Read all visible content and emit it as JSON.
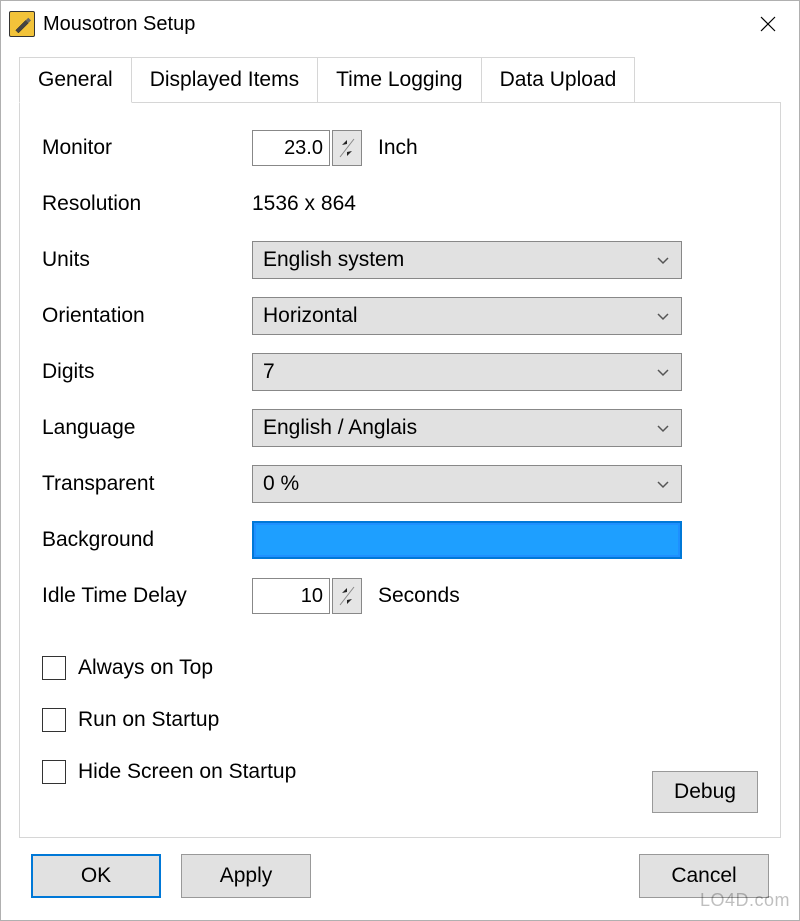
{
  "titlebar": {
    "title": "Mousotron Setup"
  },
  "tabs": {
    "general": "General",
    "displayed_items": "Displayed Items",
    "time_logging": "Time Logging",
    "data_upload": "Data Upload"
  },
  "form": {
    "monitor_label": "Monitor",
    "monitor_value": "23.0",
    "monitor_unit": "Inch",
    "resolution_label": "Resolution",
    "resolution_value": "1536 x 864",
    "units_label": "Units",
    "units_value": "English system",
    "orientation_label": "Orientation",
    "orientation_value": "Horizontal",
    "digits_label": "Digits",
    "digits_value": "7",
    "language_label": "Language",
    "language_value": "English / Anglais",
    "transparent_label": "Transparent",
    "transparent_value": "0 %",
    "background_label": "Background",
    "background_color": "#1E9FFF",
    "idle_label": "Idle Time Delay",
    "idle_value": "10",
    "idle_unit": "Seconds"
  },
  "checkboxes": {
    "always_on_top": "Always on Top",
    "run_on_startup": "Run on Startup",
    "hide_on_startup": "Hide Screen on Startup"
  },
  "buttons": {
    "debug": "Debug",
    "ok": "OK",
    "apply": "Apply",
    "cancel": "Cancel"
  },
  "watermark": "LO4D.com"
}
